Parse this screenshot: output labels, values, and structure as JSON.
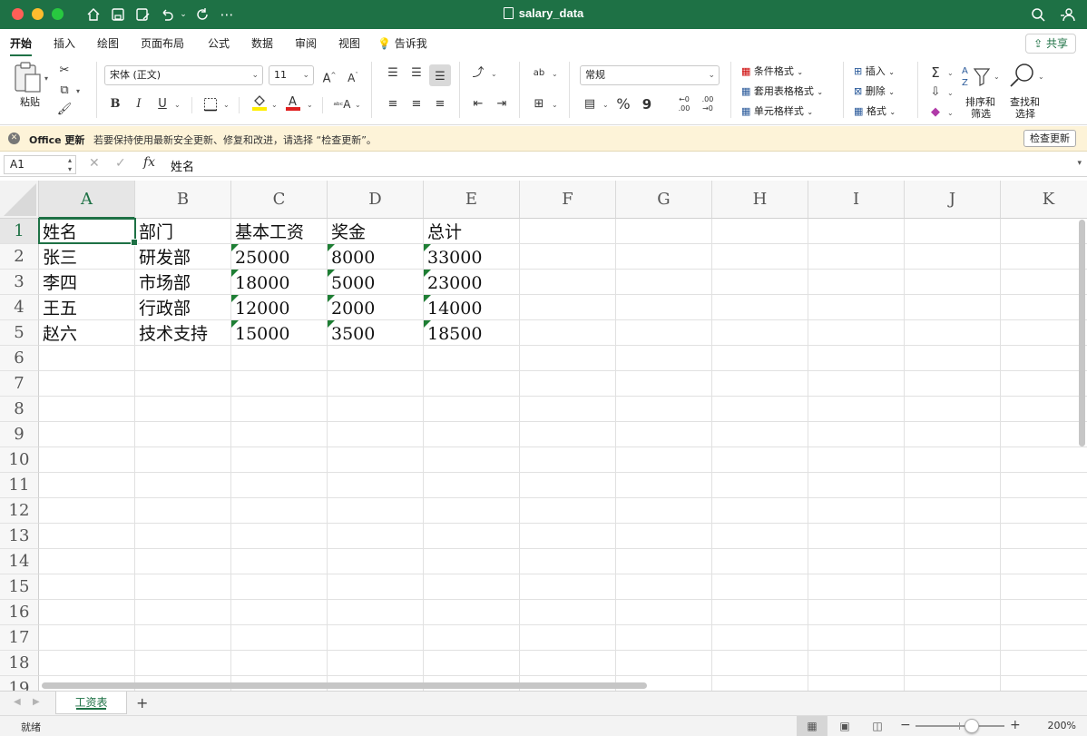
{
  "window": {
    "title": "salary_data"
  },
  "titlebar_icons": [
    "home-icon",
    "save-icon",
    "save-as-icon",
    "undo-icon",
    "redo-icon",
    "more-icon",
    "search-icon",
    "people-icon"
  ],
  "ribbon_tabs": [
    {
      "label": "开始",
      "active": true
    },
    {
      "label": "插入"
    },
    {
      "label": "绘图"
    },
    {
      "label": "页面布局"
    },
    {
      "label": "公式"
    },
    {
      "label": "数据"
    },
    {
      "label": "审阅"
    },
    {
      "label": "视图"
    },
    {
      "label": "告诉我"
    }
  ],
  "share_label": "共享",
  "ribbon": {
    "paste_label": "粘贴",
    "font_name": "宋体 (正文)",
    "font_size": "11",
    "bold": "B",
    "italic": "I",
    "underline": "U",
    "number_format": "常规",
    "percent": "%",
    "comma": "9",
    "cond_format": "条件格式",
    "table_format": "套用表格格式",
    "cell_style": "单元格样式",
    "insert": "插入",
    "delete": "删除",
    "format": "格式",
    "sort_filter_1": "排序和",
    "sort_filter_2": "筛选",
    "find_select_1": "查找和",
    "find_select_2": "选择"
  },
  "notice": {
    "title": "Office 更新",
    "message": "若要保持使用最新安全更新、修复和改进，请选择 “检查更新”。",
    "button": "检查更新"
  },
  "formula_bar": {
    "name_box": "A1",
    "fx": "fx",
    "content": "姓名"
  },
  "columns": [
    "A",
    "B",
    "C",
    "D",
    "E",
    "F",
    "G",
    "H",
    "I",
    "J",
    "K"
  ],
  "rows": [
    "1",
    "2",
    "3",
    "4",
    "5",
    "6",
    "7",
    "8",
    "9",
    "10",
    "11",
    "12",
    "13",
    "14",
    "15",
    "16",
    "17",
    "18",
    "19"
  ],
  "table": {
    "header": [
      "姓名",
      "部门",
      "基本工资",
      "奖金",
      "总计"
    ],
    "rows": [
      [
        "张三",
        "研发部",
        "25000",
        "8000",
        "33000"
      ],
      [
        "李四",
        "市场部",
        "18000",
        "5000",
        "23000"
      ],
      [
        "王五",
        "行政部",
        "12000",
        "2000",
        "14000"
      ],
      [
        "赵六",
        "技术支持",
        "15000",
        "3500",
        "18500"
      ]
    ]
  },
  "sheet_tabs": [
    {
      "label": "工资表",
      "active": true
    }
  ],
  "status": {
    "text": "就绪",
    "zoom": "200%"
  },
  "colors": {
    "brand": "#1e7145",
    "number_marker": "#1e7e34"
  }
}
